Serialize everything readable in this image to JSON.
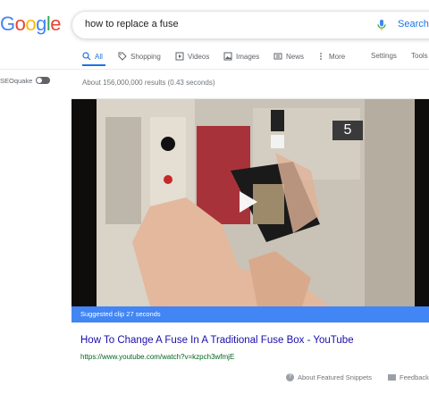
{
  "logo": {
    "letters": [
      "G",
      "o",
      "o",
      "g",
      "l",
      "e"
    ],
    "colors": [
      "#4285F4",
      "#EA4335",
      "#FBBC05",
      "#4285F4",
      "#34A853",
      "#EA4335"
    ]
  },
  "search": {
    "query": "how to replace a fuse",
    "button_label": "Search"
  },
  "tabs": [
    {
      "label": "All",
      "icon": "search-icon",
      "active": true
    },
    {
      "label": "Shopping",
      "icon": "tag-icon"
    },
    {
      "label": "Videos",
      "icon": "play-box-icon"
    },
    {
      "label": "Images",
      "icon": "image-icon"
    },
    {
      "label": "News",
      "icon": "newspaper-icon"
    },
    {
      "label": "More",
      "icon": "more-vert-icon"
    },
    {
      "label": "Settings"
    },
    {
      "label": "Tools"
    }
  ],
  "sidebar": {
    "seoquake_label": "SEOquake"
  },
  "results_count": "About 156,000,000 results (0.43 seconds)",
  "featured": {
    "clip_number": "5",
    "suggested_clip": "Suggested clip 27 seconds",
    "title": "How To Change A Fuse In A Traditional Fuse Box - YouTube",
    "url": "https://www.youtube.com/watch?v=kzpch3wfmjE"
  },
  "footer": {
    "about": "About Featured Snippets",
    "feedback": "Feedback"
  },
  "colors": {
    "accent": "#1a73e8",
    "link": "#1a0dab",
    "url": "#006621",
    "suggested_bar": "#4285f4"
  }
}
